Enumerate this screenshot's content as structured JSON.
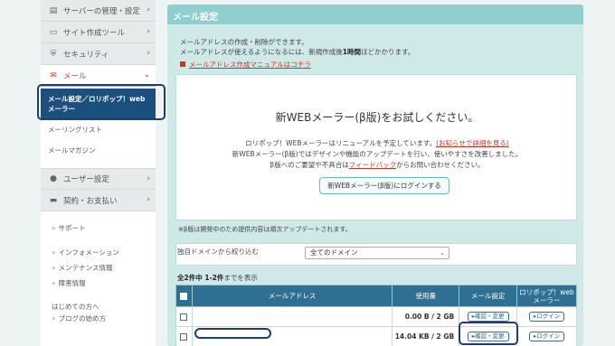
{
  "sidebar": {
    "items": [
      {
        "label": "サーバーの管理・設定",
        "icon": "server-icon"
      },
      {
        "label": "サイト作成ツール",
        "icon": "monitor-icon"
      },
      {
        "label": "セキュリティ",
        "icon": "shield-icon"
      },
      {
        "label": "メール",
        "icon": "mail-icon"
      }
    ],
    "mail_sub": {
      "active": "メール設定／ロリポップ！webメーラー",
      "items": [
        "メーリングリスト",
        "メールマガジン"
      ]
    },
    "items2": [
      {
        "label": "ユーザー設定",
        "icon": "user-icon"
      },
      {
        "label": "契約・お支払い",
        "icon": "card-icon"
      }
    ],
    "links": [
      "サポート",
      "インフォメーション",
      "メンテナンス情報",
      "障害情報"
    ],
    "beginner_title": "はじめての方へ",
    "blog_link": "ブログの始め方"
  },
  "page": {
    "title": "メール設定",
    "intro1": "メールアドレスの作成・削除ができます。",
    "intro2_pre": "メールアドレスが使えるようになるには、新規作成後",
    "intro2_bold": "1時間",
    "intro2_post": "ほどかかります。",
    "manual_link": "メールアドレス作成マニュアルはコチラ"
  },
  "promo": {
    "title": "新WEBメーラー(β版)をお試しください。",
    "line1_pre": "ロリポップ！WEBメーラーはリニューアルを予定しています。",
    "line1_link": "(お知らせで詳細を見る)",
    "line2": "新WEBメーラー(β版)ではデザインや機能のアップデートを行い、使いやすさを改善しました。",
    "line3_pre": "β版へのご要望や不具合は",
    "line3_link": "フィードバック",
    "line3_post": "からお問い合わせください。",
    "button": "新WEBメーラー(β版)にログインする"
  },
  "beta_note": "※β版は開発中のため提供内容は順次アップデートされます。",
  "filter": {
    "label": "独自ドメインから絞り込む",
    "selected": "全てのドメイン"
  },
  "count": {
    "bold": "全2件中 1-2件",
    "rest": "までを表示"
  },
  "table": {
    "headers": {
      "address": "メールアドレス",
      "usage": "使用量",
      "settings": "メール設定",
      "webmail": "ロリポップ！webメーラー"
    },
    "rows": [
      {
        "address": "",
        "usage": "0.00 B / 2 GB",
        "settings_btn": "▸確認・変更",
        "webmail_btn": "▸ログイン"
      },
      {
        "address": "",
        "usage": "14.04 KB / 2 GB",
        "settings_btn": "▸確認・変更",
        "webmail_btn": "▸ログイン"
      }
    ]
  }
}
